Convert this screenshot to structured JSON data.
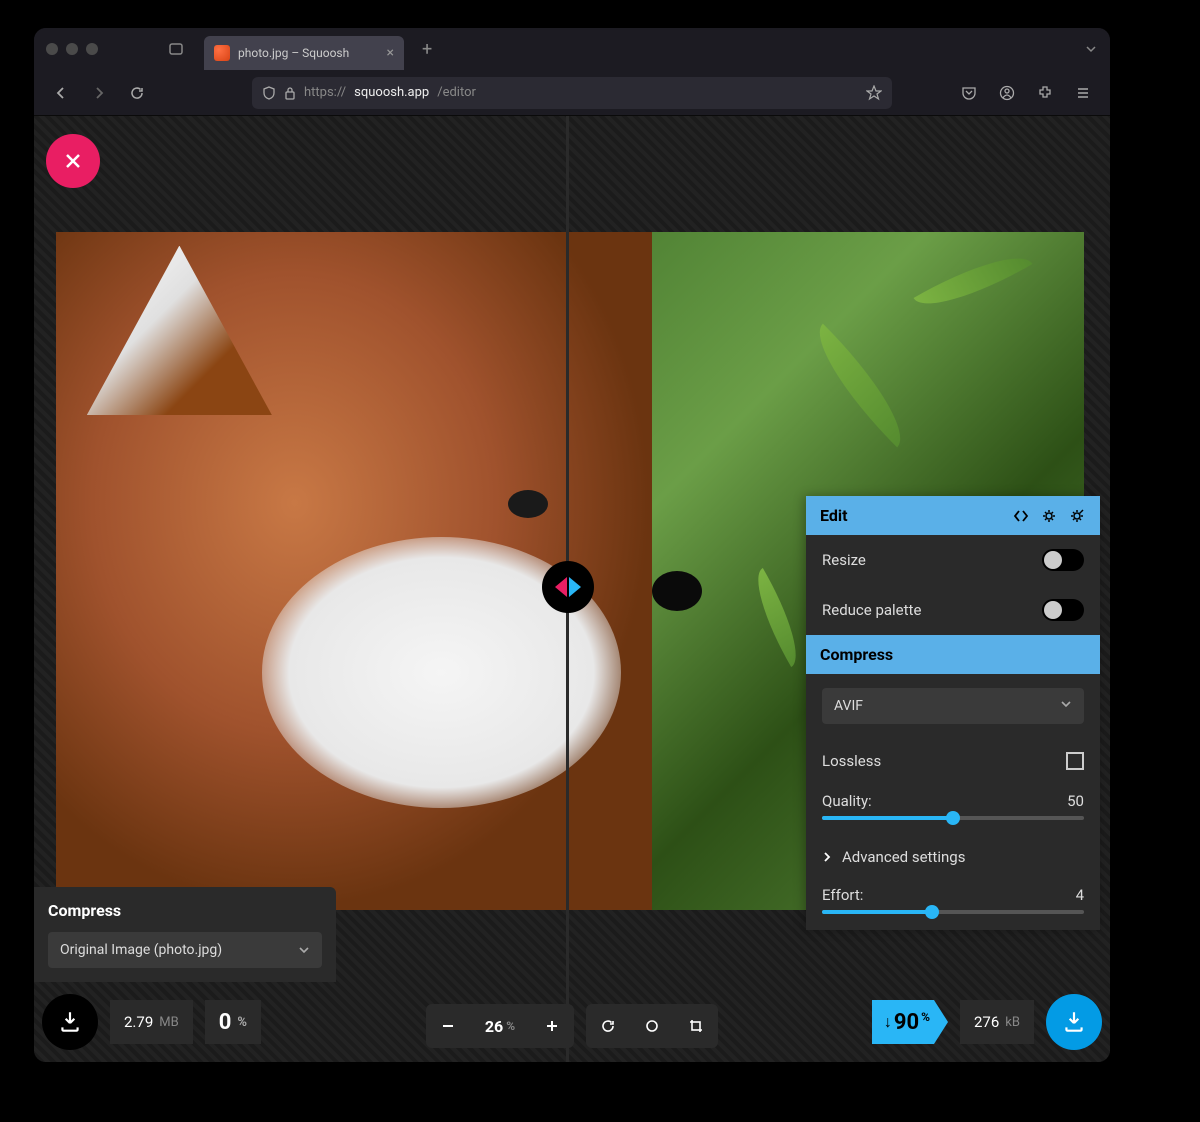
{
  "browser": {
    "tab_title": "photo.jpg – Squoosh",
    "url_prefix": "https://",
    "url_host": "squoosh.app",
    "url_path": "/editor"
  },
  "left_panel": {
    "title": "Compress",
    "select_value": "Original Image (photo.jpg)",
    "size_value": "2.79",
    "size_unit": "MB",
    "ratio_value": "0",
    "ratio_unit": "%"
  },
  "right_edit": {
    "title": "Edit",
    "resize_label": "Resize",
    "reduce_label": "Reduce palette",
    "compress_label": "Compress",
    "format_value": "AVIF",
    "lossless_label": "Lossless",
    "quality_label": "Quality:",
    "quality_value": "50",
    "advanced_label": "Advanced settings",
    "effort_label": "Effort:",
    "effort_value": "4"
  },
  "right_stats": {
    "reduction_arrow": "↓",
    "reduction_value": "90",
    "reduction_unit": "%",
    "size_value": "276",
    "size_unit": "kB"
  },
  "zoom": {
    "value": "26",
    "unit": "%"
  }
}
